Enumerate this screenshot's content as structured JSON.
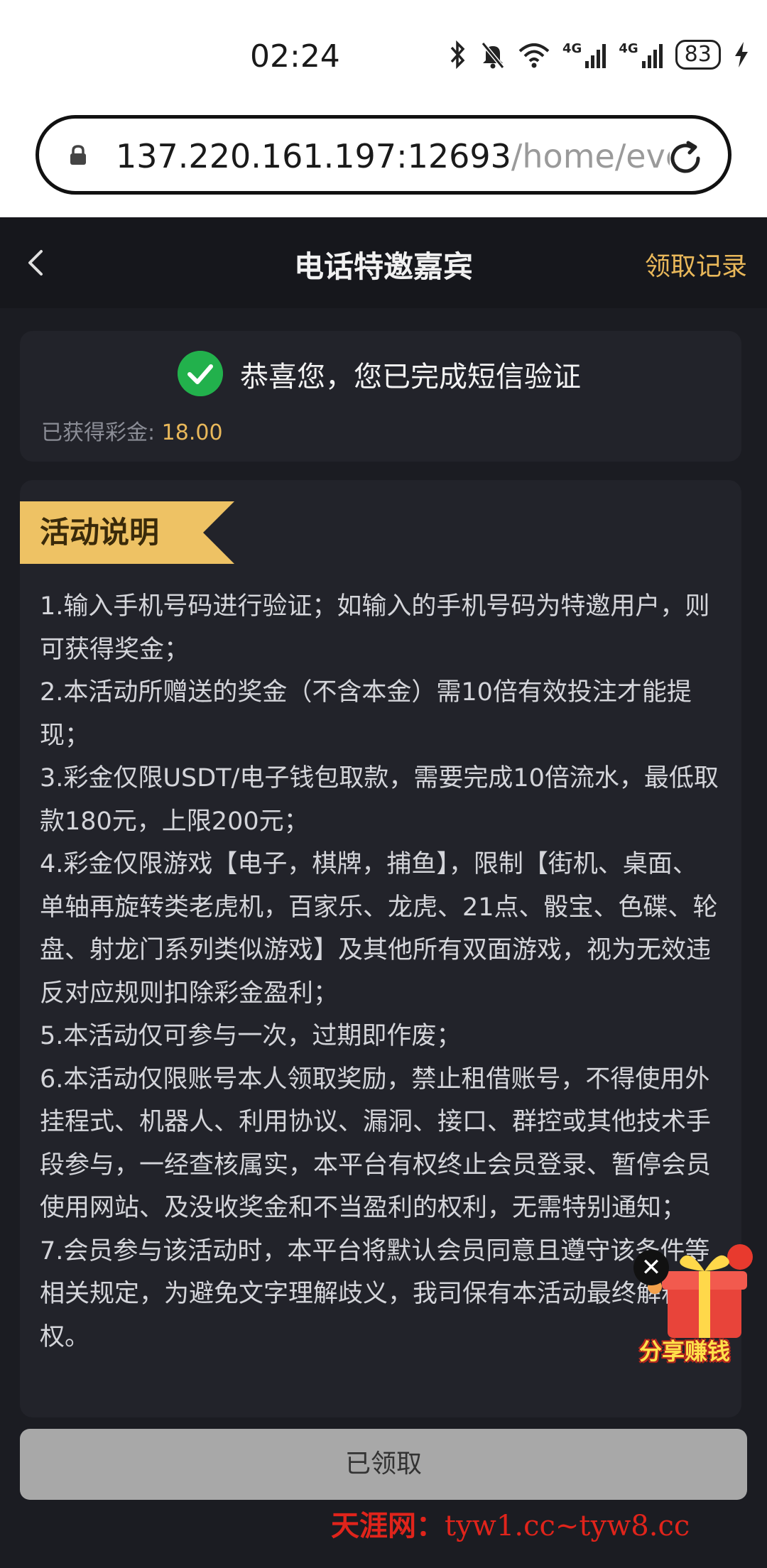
{
  "status_bar": {
    "time": "02:24",
    "battery": "83",
    "network_1": "4G",
    "network_2": "4G"
  },
  "browser": {
    "url_host": "137.220.161.197:12693",
    "url_path": "/home/eve"
  },
  "header": {
    "title": "电话特邀嘉宾",
    "records_link": "领取记录"
  },
  "result": {
    "message": "恭喜您，您已完成短信验证",
    "earned_label": "已获得彩金:",
    "earned_amount": "18.00"
  },
  "rules": {
    "title": "活动说明",
    "items": [
      "1.输入手机号码进行验证；如输入的手机号码为特邀用户，则可获得奖金；",
      "2.本活动所赠送的奖金（不含本金）需10倍有效投注才能提现；",
      "3.彩金仅限USDT/电子钱包取款，需要完成10倍流水，最低取款180元，上限200元；",
      "4.彩金仅限游戏【电子，棋牌，捕鱼】，限制【街机、桌面、单轴再旋转类老虎机，百家乐、龙虎、21点、骰宝、色碟、轮盘、射龙门系列类似游戏】及其他所有双面游戏，视为无效违反对应规则扣除彩金盈利；",
      "5.本活动仅可参与一次，过期即作废；",
      "6.本活动仅限账号本人领取奖励，禁止租借账号，不得使用外挂程式、机器人、利用协议、漏洞、接口、群控或其他技术手段参与，一经查核属实，本平台有权终止会员登录、暂停会员使用网站、及没收奖金和不当盈利的权利，无需特别通知；",
      "7.会员参与该活动时，本平台将默认会员同意且遵守该条件等相关规定，为避免文字理解歧义，我司保有本活动最终解释权。"
    ]
  },
  "share_widget": {
    "label": "分享赚钱",
    "close": "✕"
  },
  "claim_button": {
    "label": "已领取"
  },
  "watermark": {
    "brand": "天涯网：",
    "site": "tyw1.cc~tyw8.cc"
  },
  "colors": {
    "accent": "#e9b85a",
    "success": "#22b14c",
    "background": "#1b1c22",
    "card": "#22232a"
  }
}
